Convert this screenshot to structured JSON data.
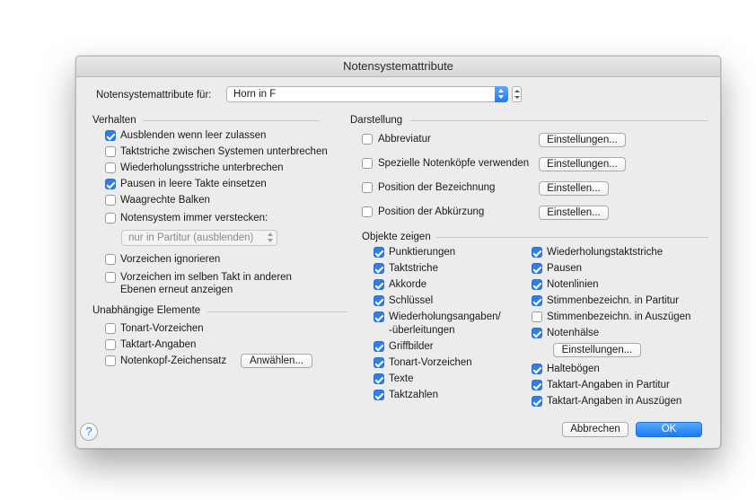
{
  "dialog": {
    "title": "Notensystemattribute",
    "header": {
      "label": "Notensystemattribute für:",
      "selected_value": "Horn in F"
    },
    "verhalten": {
      "title": "Verhalten",
      "items": [
        {
          "label": "Ausblenden wenn leer zulassen",
          "checked": true
        },
        {
          "label": "Taktstriche zwischen Systemen unterbrechen",
          "checked": false
        },
        {
          "label": "Wiederholungsstriche unterbrechen",
          "checked": false
        },
        {
          "label": "Pausen in leere Takte einsetzen",
          "checked": true
        },
        {
          "label": "Waagrechte Balken",
          "checked": false
        },
        {
          "label": "Notensystem immer verstecken:",
          "checked": false
        }
      ],
      "hide_mode_select": "nur in Partitur (ausblenden)",
      "items2": [
        {
          "label": "Vorzeichen ignorieren",
          "checked": false
        },
        {
          "label": "Vorzeichen im selben Takt in anderen",
          "label2": "Ebenen erneut anzeigen",
          "checked": false
        }
      ]
    },
    "unabhaengig": {
      "title": "Unabhängige Elemente",
      "items": [
        {
          "label": "Tonart-Vorzeichen",
          "checked": false
        },
        {
          "label": "Taktart-Angaben",
          "checked": false
        },
        {
          "label": "Notenkopf-Zeichensatz",
          "checked": false
        }
      ],
      "choose_button": "Anwählen..."
    },
    "darstellung": {
      "title": "Darstellung",
      "items": [
        {
          "label": "Abbreviatur",
          "checked": false,
          "button": "Einstellungen..."
        },
        {
          "label": "Spezielle Notenköpfe verwenden",
          "checked": false,
          "button": "Einstellungen..."
        },
        {
          "label": "Position der Bezeichnung",
          "checked": false,
          "button": "Einstellen..."
        },
        {
          "label": "Position der Abkürzung",
          "checked": false,
          "button": "Einstellen..."
        }
      ]
    },
    "objekte": {
      "title": "Objekte zeigen",
      "left": [
        {
          "label": "Punktierungen",
          "checked": true
        },
        {
          "label": "Taktstriche",
          "checked": true
        },
        {
          "label": "Akkorde",
          "checked": true
        },
        {
          "label": "Schlüssel",
          "checked": true
        },
        {
          "label": "Wiederholungsangaben/",
          "label2": "-überleitungen",
          "checked": true
        },
        {
          "label": "Griffbilder",
          "checked": true
        },
        {
          "label": "Tonart-Vorzeichen",
          "checked": true
        },
        {
          "label": "Texte",
          "checked": true
        },
        {
          "label": "Taktzahlen",
          "checked": true
        }
      ],
      "right": [
        {
          "label": "Wiederholungstaktstriche",
          "checked": true
        },
        {
          "label": "Pausen",
          "checked": true
        },
        {
          "label": "Notenlinien",
          "checked": true
        },
        {
          "label": "Stimmenbezeichn. in Partitur",
          "checked": true
        },
        {
          "label": "Stimmenbezeichn. in Auszügen",
          "checked": false
        },
        {
          "label": "Notenhälse",
          "checked": true
        }
      ],
      "stems_button": "Einstellungen...",
      "right2": [
        {
          "label": "Haltebögen",
          "checked": true
        },
        {
          "label": "Taktart-Angaben in Partitur",
          "checked": true
        },
        {
          "label": "Taktart-Angaben in Auszügen",
          "checked": true
        }
      ]
    },
    "footer": {
      "help": "?",
      "cancel": "Abbrechen",
      "ok": "OK"
    }
  },
  "colors": {
    "accent": "#2f7fe6",
    "dialog_bg": "#ececec"
  }
}
